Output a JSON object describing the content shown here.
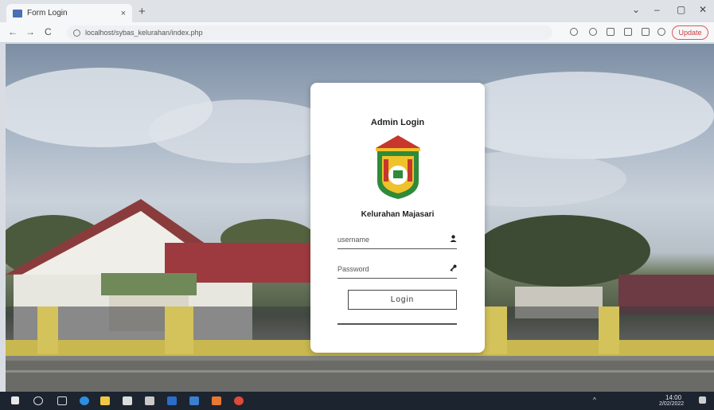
{
  "browser": {
    "tab_title": "Form Login",
    "tab_close": "×",
    "new_tab": "+",
    "window_controls": [
      "⌄",
      "–",
      "▢",
      "✕"
    ],
    "nav": [
      "←",
      "→",
      "C"
    ],
    "url": "localhost/sybas_kelurahan/index.php",
    "update_label": "Update"
  },
  "login": {
    "title": "Admin Login",
    "subtitle": "Kelurahan Majasari",
    "username_placeholder": "username",
    "password_placeholder": "Password",
    "button_label": "Login"
  },
  "taskbar": {
    "time": "14:00",
    "date": "2/02/2022"
  },
  "colors": {
    "accent": "#d03b3b",
    "card": "#ffffff",
    "emblem_green": "#2f8a3a",
    "emblem_red": "#c7372d",
    "emblem_yellow": "#f0c22a"
  }
}
